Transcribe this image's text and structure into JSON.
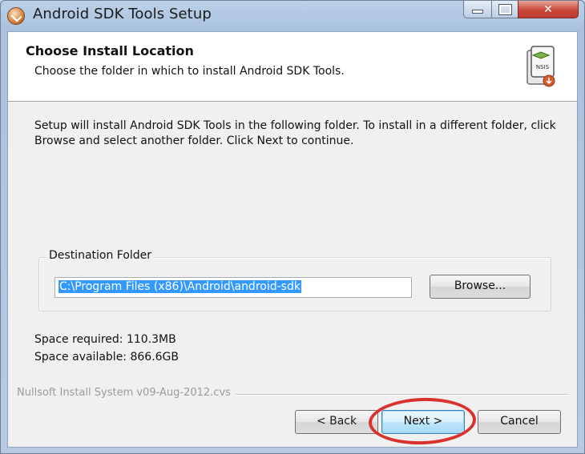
{
  "window": {
    "title": "Android SDK Tools Setup",
    "close_glyph": "✕"
  },
  "header": {
    "title": "Choose Install Location",
    "subtitle": "Choose the folder in which to install Android SDK Tools.",
    "icon": "nsis-installer-icon",
    "icon_label": "NSIS"
  },
  "body": {
    "instructions": "Setup will install Android SDK Tools in the following folder. To install in a different folder, click Browse and select another folder. Click Next to continue."
  },
  "destination": {
    "group_label": "Destination Folder",
    "path_value": "C:\\Program Files (x86)\\Android\\android-sdk",
    "browse_label": "Browse..."
  },
  "space": {
    "required": "Space required: 110.3MB",
    "available": "Space available: 866.6GB"
  },
  "footer": {
    "branding": "Nullsoft Install System v09-Aug-2012.cvs",
    "back_label": "< Back",
    "next_label": "Next >",
    "cancel_label": "Cancel"
  },
  "colors": {
    "annotation_circle": "#d9312b",
    "selection": "#3399ff",
    "close_button": "#c9463a"
  }
}
